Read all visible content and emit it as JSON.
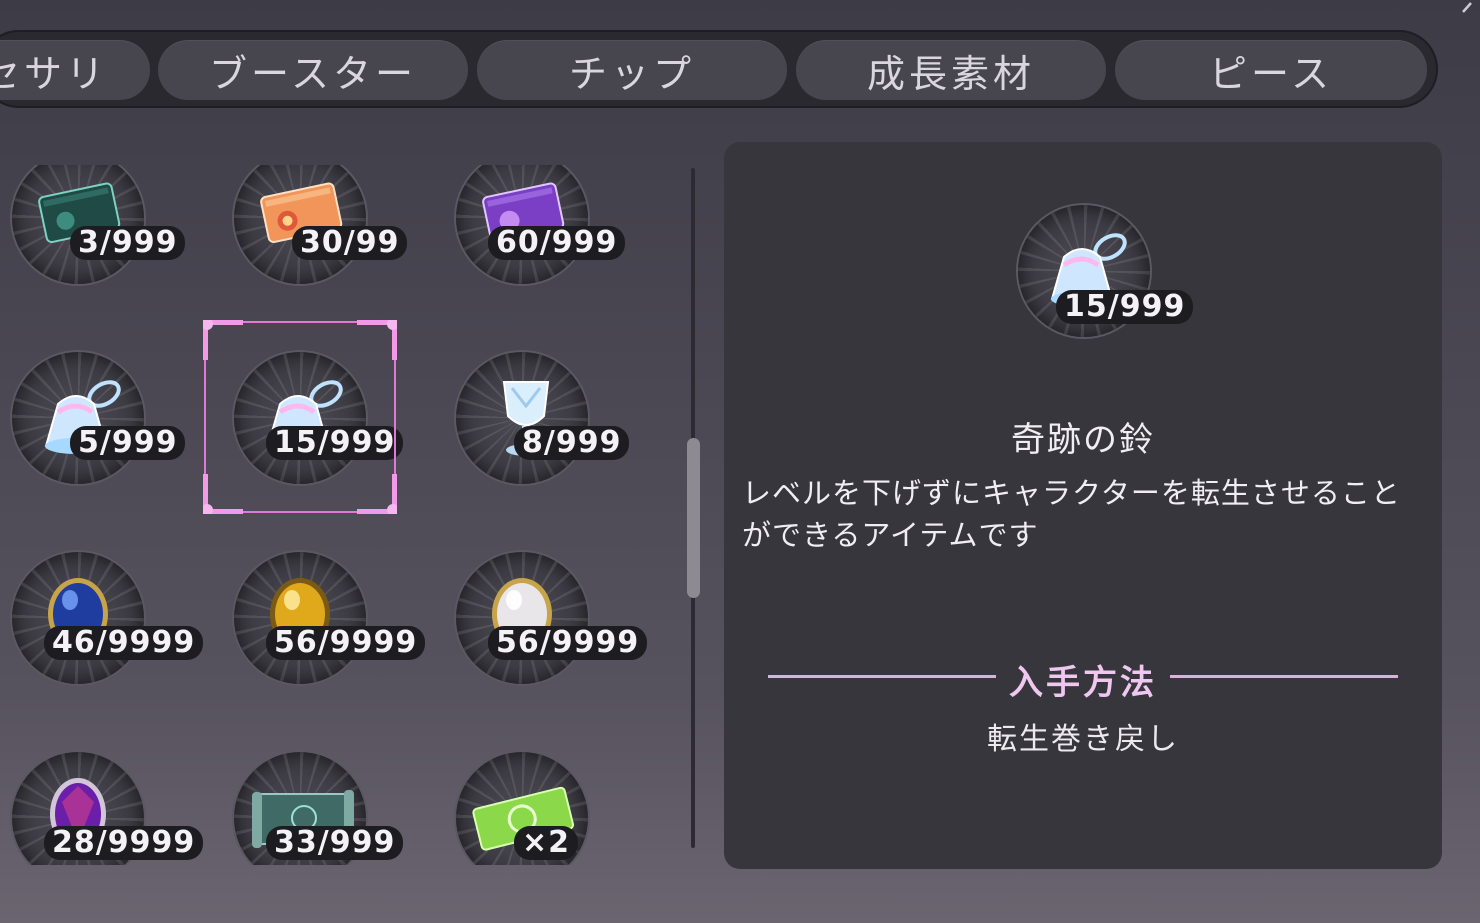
{
  "tabs": [
    {
      "label": "セサリ",
      "name": "tab-accessory"
    },
    {
      "label": "ブースター",
      "name": "tab-booster"
    },
    {
      "label": "チップ",
      "name": "tab-chip"
    },
    {
      "label": "成長素材",
      "name": "tab-growth-material"
    },
    {
      "label": "ピース",
      "name": "tab-piece"
    }
  ],
  "items": [
    {
      "icon": "green-card-icon",
      "count": "3/999"
    },
    {
      "icon": "orange-card-icon",
      "count": "30/99"
    },
    {
      "icon": "purple-card-icon",
      "count": "60/999"
    },
    {
      "icon": "bell-icon",
      "count": "5/999"
    },
    {
      "icon": "bell-icon",
      "count": "15/999",
      "selected": true
    },
    {
      "icon": "goblet-icon",
      "count": "8/999"
    },
    {
      "icon": "blue-orb-icon",
      "count": "46/9999"
    },
    {
      "icon": "gold-orb-icon",
      "count": "56/9999"
    },
    {
      "icon": "pearl-orb-icon",
      "count": "56/9999"
    },
    {
      "icon": "purple-gem-icon",
      "count": "28/9999"
    },
    {
      "icon": "scroll-map-icon",
      "count": "33/999"
    },
    {
      "icon": "green-ticket-icon",
      "count": "×2"
    }
  ],
  "detail": {
    "icon": "bell-icon",
    "count": "15/999",
    "name": "奇跡の鈴",
    "description": "レベルを下げずにキャラクターを転生させることができるアイテムです",
    "acquisition_heading": "入手方法",
    "acquisition_method": "転生巻き戻し"
  },
  "colors": {
    "selection": "#e07ad6",
    "accent_line": "#d8b3dc",
    "panel": "#37363d"
  }
}
